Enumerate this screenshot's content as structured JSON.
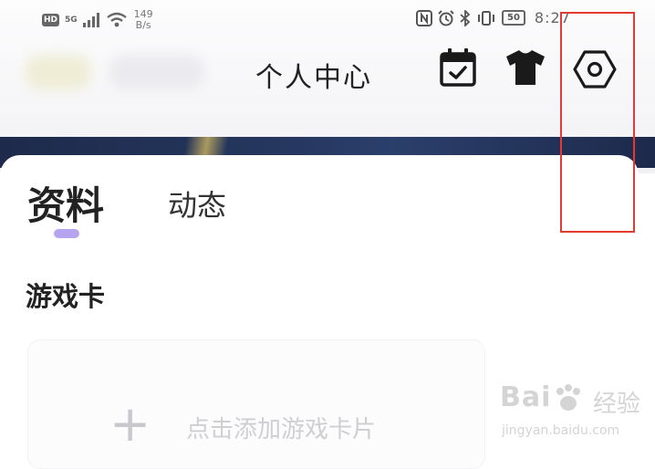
{
  "status_bar": {
    "hd_badge": "HD",
    "network_type": "5G",
    "speed_value": "149",
    "speed_unit": "B/s",
    "icons": [
      "signal-icon",
      "wifi-icon",
      "nfc-icon",
      "alarm-icon",
      "bluetooth-icon",
      "vibrate-icon"
    ],
    "battery": "50",
    "time": "8:27"
  },
  "header": {
    "title": "个人中心",
    "icons": [
      "calendar-check-icon",
      "tshirt-icon",
      "hexagon-settings-icon"
    ]
  },
  "tabs": [
    {
      "label": "资料",
      "active": true
    },
    {
      "label": "动态",
      "active": false
    }
  ],
  "game_card_section": {
    "title": "游戏卡",
    "add_label": "点击添加游戏卡片",
    "add_icon": "+"
  },
  "colors": {
    "tab_indicator": "#b6a4f0",
    "highlight_box": "#e53935",
    "banner": "#1d2a4b"
  },
  "watermark": {
    "main": "Bai",
    "chinese": "经验",
    "url": "jingyan.baidu.com"
  }
}
